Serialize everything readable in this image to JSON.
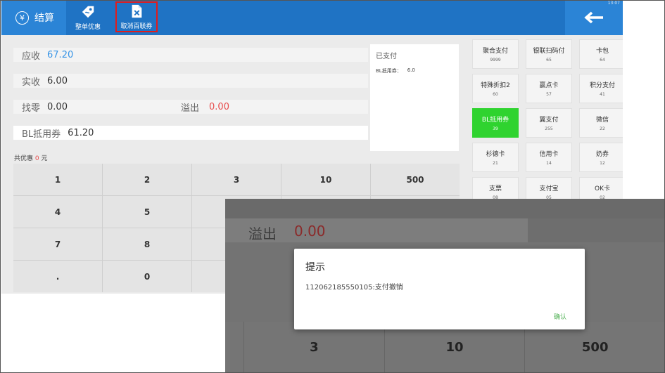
{
  "status_bar": {
    "time": "13:07"
  },
  "header": {
    "title": "结算",
    "title_icon": "yen-circle-icon",
    "buttons": [
      {
        "label": "整单优惠",
        "icon": "tag-icon"
      },
      {
        "label": "取消百联券",
        "icon": "cancel-document-icon"
      }
    ],
    "back_icon": "arrow-left-icon",
    "colors": {
      "bar": "#1f73c4",
      "accent": "#2b84d6",
      "highlight_border": "#e01c1c"
    }
  },
  "summary": {
    "receivable_label": "应收",
    "receivable_value": "67.20",
    "received_label": "实收",
    "received_value": "6.00",
    "change_label": "找零",
    "change_value": "0.00",
    "overflow_label": "溢出",
    "overflow_value": "0.00",
    "voucher_label": "BL抵用券",
    "voucher_value": "61.20"
  },
  "paid": {
    "title": "已支付",
    "line_label": "BL抵用券：",
    "line_value": "6.0"
  },
  "discount_note": {
    "prefix": "共优惠",
    "amount": "0",
    "suffix": "元"
  },
  "keypad": {
    "keys": [
      "1",
      "2",
      "3",
      "10",
      "500",
      "4",
      "5",
      "",
      "",
      "",
      "7",
      "8",
      "",
      "",
      "",
      ".",
      "0",
      "",
      "",
      ""
    ]
  },
  "payment_methods": [
    {
      "name": "聚合支付",
      "code": "9999"
    },
    {
      "name": "银联扫码付",
      "code": "65"
    },
    {
      "name": "卡包",
      "code": "64"
    },
    {
      "name": "特殊折扣2",
      "code": "60"
    },
    {
      "name": "赢点卡",
      "code": "57"
    },
    {
      "name": "积分支付",
      "code": "41"
    },
    {
      "name": "BL抵用券",
      "code": "39",
      "active": true
    },
    {
      "name": "翼支付",
      "code": "255"
    },
    {
      "name": "微信",
      "code": "22"
    },
    {
      "name": "杉德卡",
      "code": "21"
    },
    {
      "name": "信用卡",
      "code": "14"
    },
    {
      "name": "奶券",
      "code": "12"
    },
    {
      "name": "支票",
      "code": "08"
    },
    {
      "name": "支付宝",
      "code": "05"
    },
    {
      "name": "OK卡",
      "code": "02"
    }
  ],
  "zoom": {
    "overflow_label": "溢出",
    "overflow_value": "0.00",
    "keys": [
      "3",
      "10",
      "500"
    ]
  },
  "dialog": {
    "title": "提示",
    "message": "112062185550105:支付撤销",
    "ok_label": "确认"
  }
}
